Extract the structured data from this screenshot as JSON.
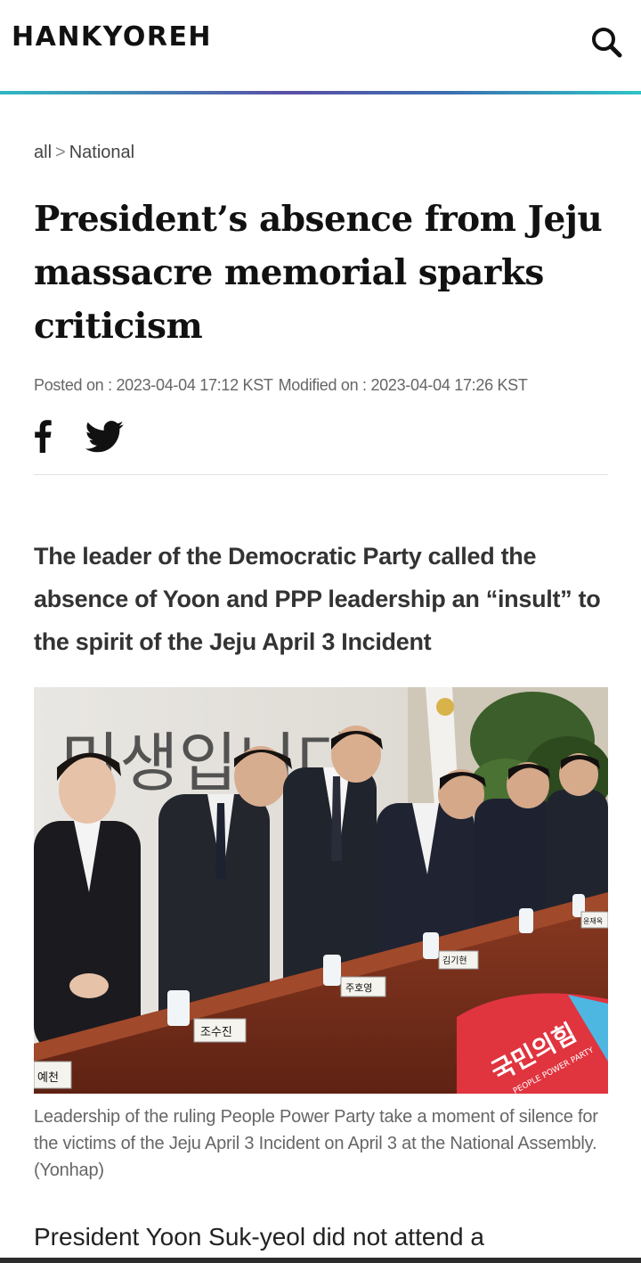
{
  "header": {
    "logo": "HANKYOREH",
    "search_icon": "search-icon"
  },
  "breadcrumb": {
    "root": "all",
    "separator": ">",
    "section": "National"
  },
  "article": {
    "headline": "President’s absence from Jeju massacre memorial sparks criticism",
    "posted": "Posted on : 2023-04-04 17:12 KST",
    "modified": "Modified on : 2023-04-04 17:26 KST",
    "subtitle": "The leader of the Democratic Party called the absence of Yoon and PPP leadership an “insult” to the spirit of the Jeju April 3 Incident",
    "photo_caption": "Leadership of the ruling People Power Party take a moment of silence for the victims of the Jeju April 3 Incident on April 3 at the National Assembly. (Yonhap)",
    "body_start": "President Yoon Suk-yeol did not attend a"
  },
  "social": {
    "facebook_icon": "facebook-icon",
    "twitter_icon": "twitter-icon"
  },
  "photo": {
    "backdrop_text": "민생입니다",
    "name_cards": [
      "예천",
      "조수진",
      "주호영",
      "김기현",
      "윤재옥"
    ],
    "podium_logo": "국민의힘",
    "podium_sub": "PEOPLE POWER PARTY"
  },
  "colors": {
    "header_line_start": "#2fb8c2",
    "header_line_mid": "#5a4fa6",
    "podium_red": "#e0343f"
  }
}
